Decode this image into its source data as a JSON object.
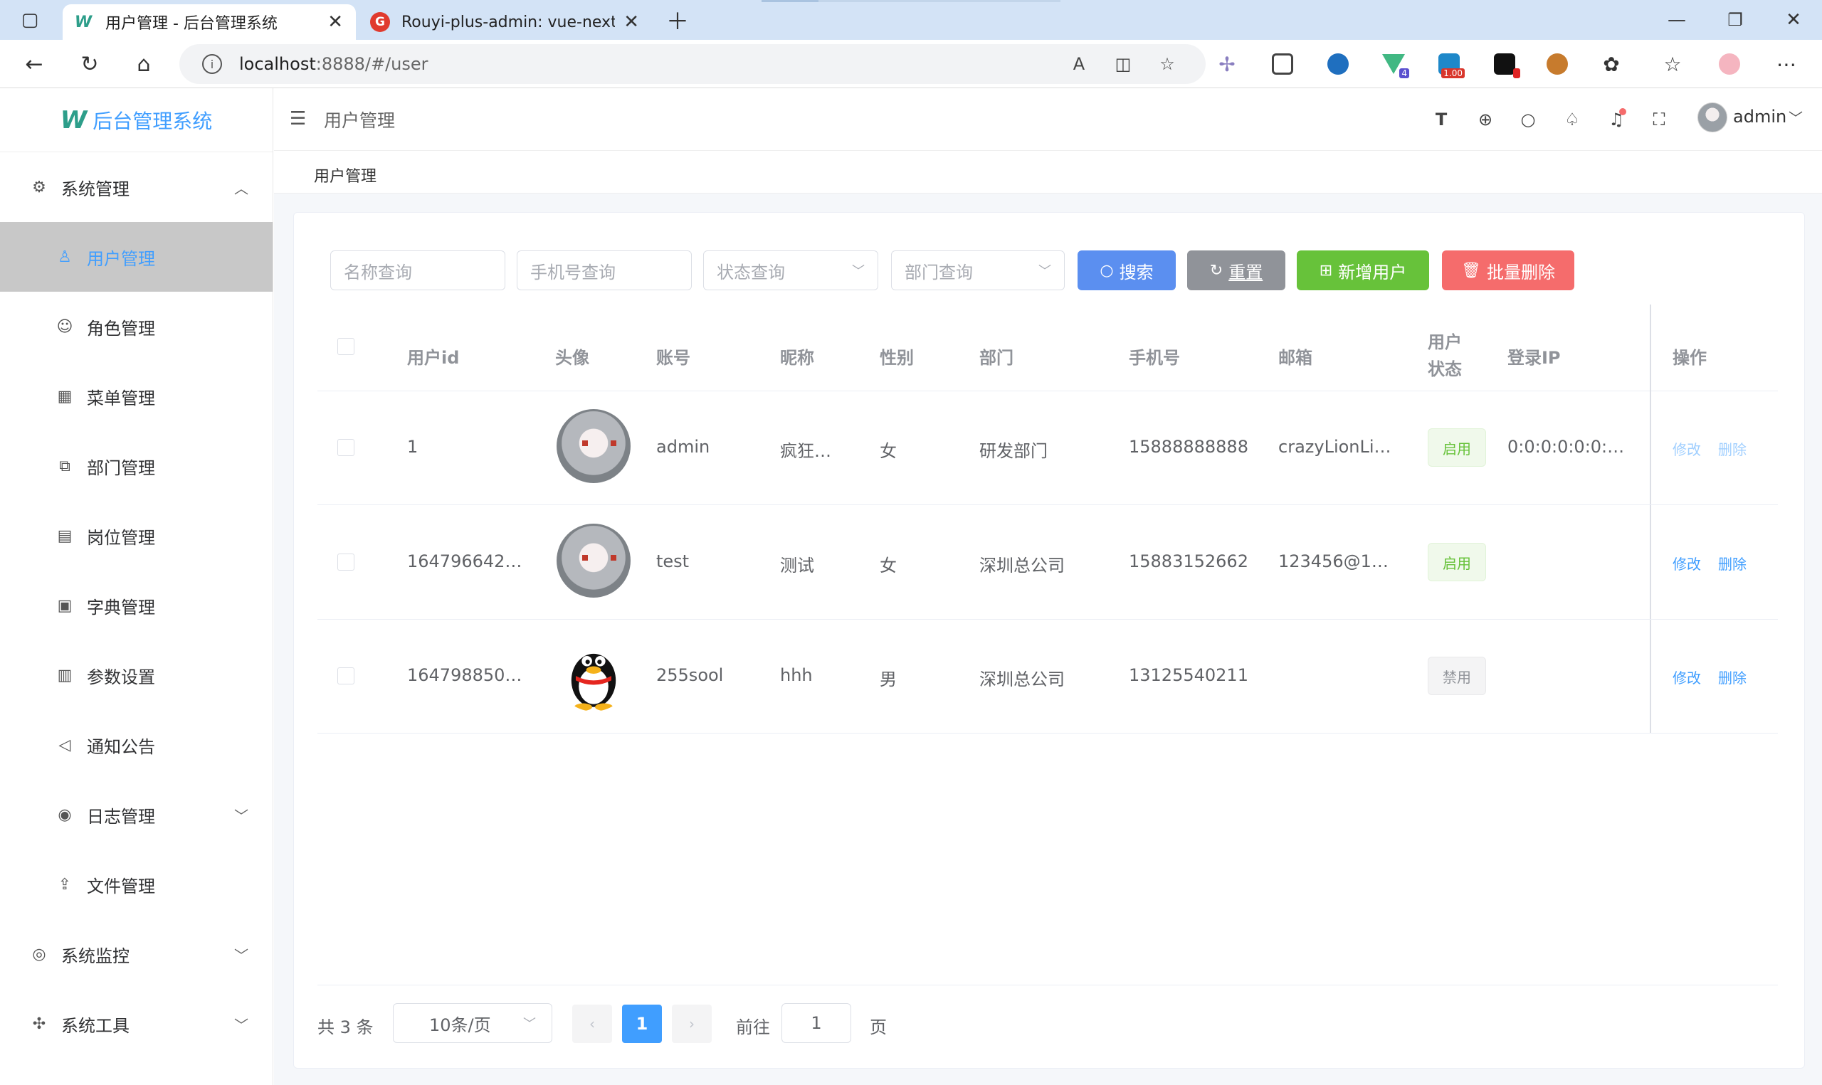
{
  "browser": {
    "tabs": [
      {
        "title": "用户管理 - 后台管理系统",
        "favicon": "W"
      },
      {
        "title": "Rouyi-plus-admin: vue-next-adm",
        "favicon": "G"
      }
    ],
    "url_host": "localhost",
    "url_rest": ":8888/#/user",
    "extension_badges": {
      "vue": "4",
      "speed": "1.00"
    }
  },
  "logo": {
    "mark": "W",
    "title": "后台管理系统"
  },
  "sidebar": {
    "items": [
      {
        "label": "系统管理",
        "icon": "gear-icon",
        "glyph": "⚙",
        "level": "top",
        "arrow": "︿"
      },
      {
        "label": "用户管理",
        "icon": "user-icon",
        "glyph": "♙",
        "level": "sub",
        "active": true
      },
      {
        "label": "角色管理",
        "icon": "role-icon",
        "glyph": "☺",
        "level": "sub"
      },
      {
        "label": "菜单管理",
        "icon": "menu-icon",
        "glyph": "▦",
        "level": "sub"
      },
      {
        "label": "部门管理",
        "icon": "dept-icon",
        "glyph": "⧉",
        "level": "sub"
      },
      {
        "label": "岗位管理",
        "icon": "post-icon",
        "glyph": "▤",
        "level": "sub"
      },
      {
        "label": "字典管理",
        "icon": "dict-icon",
        "glyph": "▣",
        "level": "sub"
      },
      {
        "label": "参数设置",
        "icon": "config-icon",
        "glyph": "▥",
        "level": "sub"
      },
      {
        "label": "通知公告",
        "icon": "notice-icon",
        "glyph": "◁",
        "level": "sub"
      },
      {
        "label": "日志管理",
        "icon": "log-icon",
        "glyph": "◉",
        "level": "sub",
        "arrow": "﹀"
      },
      {
        "label": "文件管理",
        "icon": "upload-icon",
        "glyph": "⇪",
        "level": "sub"
      },
      {
        "label": "系统监控",
        "icon": "monitor-icon",
        "glyph": "◎",
        "level": "top",
        "arrow": "﹀"
      },
      {
        "label": "系统工具",
        "icon": "tool-icon",
        "glyph": "✣",
        "level": "top",
        "arrow": "﹀"
      }
    ]
  },
  "header": {
    "breadcrumb": "用户管理",
    "username": "admin"
  },
  "tagsbar": {
    "active_tag": "用户管理"
  },
  "search": {
    "name_placeholder": "名称查询",
    "phone_placeholder": "手机号查询",
    "status_placeholder": "状态查询",
    "dept_placeholder": "部门查询"
  },
  "buttons": {
    "search": "搜索",
    "reset": "重置",
    "add": "新增用户",
    "batch_delete": "批量删除"
  },
  "colors": {
    "primary": "#409eff",
    "search_btn": "#5b8ff0",
    "reset_btn": "#909399",
    "add_btn": "#67c23a",
    "delete_btn": "#f56c6c"
  },
  "table": {
    "headers": {
      "id": "用户id",
      "avatar": "头像",
      "account": "账号",
      "nickname": "昵称",
      "gender": "性别",
      "dept": "部门",
      "phone": "手机号",
      "email": "邮箱",
      "status_line1": "用户",
      "status_line2": "状态",
      "login_ip": "登录IP",
      "actions": "操作"
    },
    "rows": [
      {
        "id": "1",
        "avatar": "anime",
        "account": "admin",
        "nickname": "疯狂…",
        "gender": "女",
        "dept": "研发部门",
        "phone": "15888888888",
        "email": "crazyLionLi…",
        "status": "启用",
        "login_ip": "0:0:0:0:0:0:…",
        "edit": "修改",
        "delete": "删除",
        "ops_enabled": false
      },
      {
        "id": "164796642…",
        "avatar": "anime",
        "account": "test",
        "nickname": "测试",
        "gender": "女",
        "dept": "深圳总公司",
        "phone": "15883152662",
        "email": "123456@1…",
        "status": "启用",
        "login_ip": "",
        "edit": "修改",
        "delete": "删除",
        "ops_enabled": true
      },
      {
        "id": "164798850…",
        "avatar": "qq",
        "account": "255sool",
        "nickname": "hhh",
        "gender": "男",
        "dept": "深圳总公司",
        "phone": "13125540211",
        "email": "",
        "status": "禁用",
        "login_ip": "",
        "edit": "修改",
        "delete": "删除",
        "ops_enabled": true
      }
    ]
  },
  "pagination": {
    "total_text": "共 3 条",
    "page_size": "10条/页",
    "current_page": "1",
    "goto_label": "前往",
    "goto_value": "1",
    "page_suffix": "页"
  }
}
